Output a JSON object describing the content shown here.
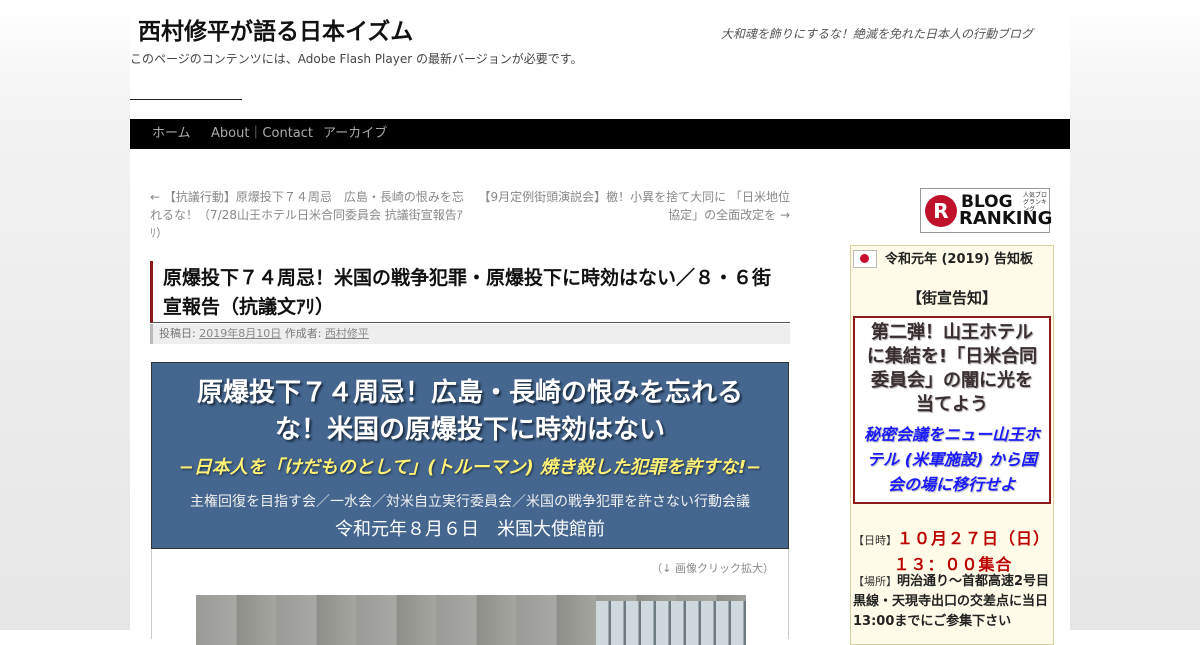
{
  "header": {
    "site_title": "西村修平が語る日本イズム",
    "site_description": "大和魂を飾りにするな！絶滅を免れた日本人の行動ブログ",
    "flash_note": "このページのコンテンツには、Adobe Flash Player の最新バージョンが必要です。"
  },
  "menu": {
    "items": [
      {
        "label": "ホーム"
      },
      {
        "label": "About｜Contact"
      },
      {
        "label": "アーカイブ"
      }
    ]
  },
  "post_nav": {
    "prev": "← 【抗議行動】原爆投下７４周忌　広島・長崎の恨みを忘れるな！（7/28山王ホテル日米合同委員会 抗議街宣報告ｱﾘ）",
    "next": "【9月定例街頭演説会】檄！小異を捨て大同に 「日米地位協定」の全面改定を →"
  },
  "post": {
    "title": "原爆投下７４周忌！米国の戦争犯罪・原爆投下に時効はない／８・６街宣報告（抗議文ｱﾘ）",
    "meta_posted_label": "投稿日:",
    "meta_date": "2019年8月10日",
    "meta_author_label": "作成者:",
    "meta_author": "西村修平",
    "banner_title": "原爆投下７４周忌！広島・長崎の恨みを忘れるな！米国の原爆投下に時効はない",
    "banner_subtitle": "−日本人を「けだものとして」(トルーマン) 焼き殺した犯罪を許すな!−",
    "banner_orgs": "主権回復を目指す会／一水会／対米自立実行委員会／米国の戦争犯罪を許さない行動会議",
    "banner_date_place": "令和元年８月６日　米国大使館前",
    "image_note": "（↓ 画像クリック拡大）"
  },
  "sidebar": {
    "ranking_label": "BLOG RANKING",
    "ranking_line1": "BLOG",
    "ranking_line2": "RANKING",
    "ranking_small": "人気ブログランキング",
    "ranking_mark": "R",
    "notice_title": "令和元年 (2019) 告知板",
    "notice_head": "【街宣告知】",
    "notice_main": "第二弾！山王ホテルに集結を!「日米合同委員会」の闇に光を当てよう",
    "notice_sub": "秘密会議をニュー山王ホテル (米軍施設) から国会の場に移行せよ",
    "when_label": "【日時】",
    "when_date": "１０月２７日（日）",
    "when_time": "１３：００集合",
    "where_label": "【場所】",
    "where_place": "明治通り～首都高速2号目黒線・天現寺出口の交差点に当日13:00までにご参集下さい"
  },
  "colors": {
    "accent_red": "#8b1a1a",
    "banner_blue": "#45678f",
    "menu_bar": "#000000",
    "notice_bg": "#fffbe8"
  }
}
